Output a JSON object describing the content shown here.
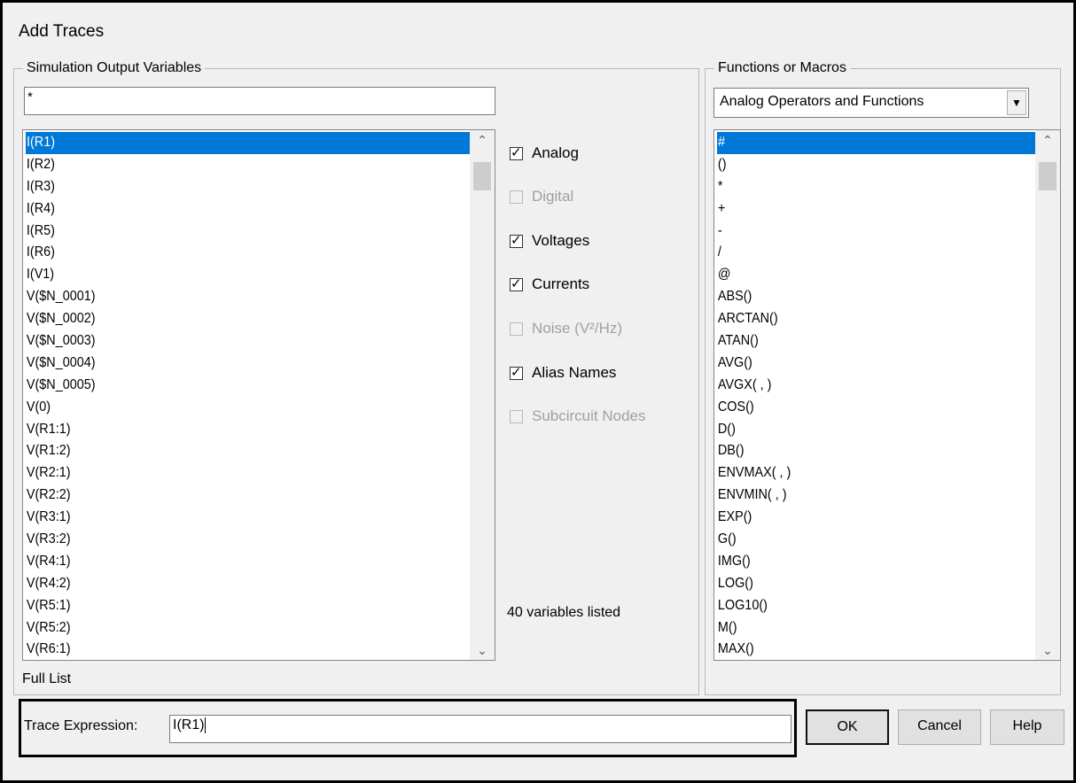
{
  "window": {
    "title": "Add Traces"
  },
  "sim_output": {
    "legend": "Simulation Output Variables",
    "filter_value": "*",
    "list_items": [
      "I(R1)",
      "I(R2)",
      "I(R3)",
      "I(R4)",
      "I(R5)",
      "I(R6)",
      "I(V1)",
      "V($N_0001)",
      "V($N_0002)",
      "V($N_0003)",
      "V($N_0004)",
      "V($N_0005)",
      "V(0)",
      "V(R1:1)",
      "V(R1:2)",
      "V(R2:1)",
      "V(R2:2)",
      "V(R3:1)",
      "V(R3:2)",
      "V(R4:1)",
      "V(R4:2)",
      "V(R5:1)",
      "V(R5:2)",
      "V(R6:1)"
    ],
    "selected_index": 0,
    "full_list_label": "Full List"
  },
  "options": {
    "analog": {
      "label": "Analog",
      "checked": true,
      "enabled": true
    },
    "digital": {
      "label": "Digital",
      "checked": false,
      "enabled": false
    },
    "voltages": {
      "label": "Voltages",
      "checked": true,
      "enabled": true
    },
    "currents": {
      "label": "Currents",
      "checked": true,
      "enabled": true
    },
    "noise": {
      "label": "Noise (V²/Hz)",
      "checked": false,
      "enabled": false
    },
    "alias_names": {
      "label": "Alias Names",
      "checked": true,
      "enabled": true
    },
    "subcircuit_nodes": {
      "label": "Subcircuit Nodes",
      "checked": false,
      "enabled": false
    },
    "variables_count": "40 variables listed"
  },
  "functions": {
    "legend": "Functions or Macros",
    "dropdown_value": "Analog Operators and Functions",
    "list_items": [
      "#",
      "()",
      "*",
      "+",
      "-",
      "/",
      "@",
      "ABS()",
      "ARCTAN()",
      "ATAN()",
      "AVG()",
      "AVGX( , )",
      "COS()",
      "D()",
      "DB()",
      "ENVMAX( , )",
      "ENVMIN( , )",
      "EXP()",
      "G()",
      "IMG()",
      "LOG()",
      "LOG10()",
      "M()",
      "MAX()"
    ],
    "selected_index": 0
  },
  "trace_expression": {
    "label": "Trace Expression:",
    "value": "I(R1)"
  },
  "buttons": {
    "ok": "OK",
    "cancel": "Cancel",
    "help": "Help"
  },
  "icons": {
    "checkmark": "checkmark-icon",
    "scroll_up": "chevron-up-icon",
    "scroll_down": "chevron-down-icon",
    "dropdown": "triangle-down-icon"
  },
  "colors": {
    "selection": "#0078d7",
    "dialog_bg": "#f0f0f0",
    "disabled_text": "#a0a0a0"
  }
}
